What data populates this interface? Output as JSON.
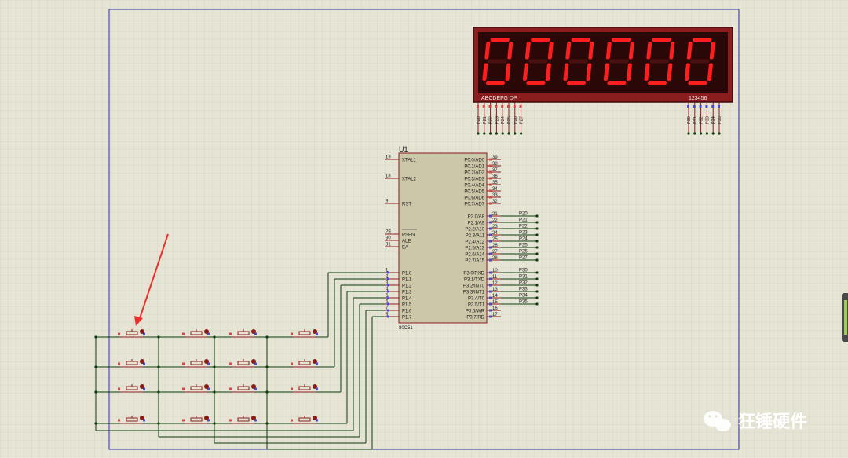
{
  "display": {
    "digits": [
      "0",
      "0",
      "0",
      "0",
      "0",
      "0"
    ],
    "seg_labels": "ABCDEFG  DP",
    "digit_labels": "123456",
    "seg_pins": [
      "P20",
      "P21",
      "P22",
      "P23",
      "P24",
      "P25",
      "P26",
      "P27"
    ],
    "dig_pins": [
      "P30",
      "P31",
      "P32",
      "P33",
      "P34",
      "P35"
    ]
  },
  "chip": {
    "ref": "U1",
    "part": "80C51",
    "left_pins": [
      {
        "num": "19",
        "name": "XTAL1"
      },
      {
        "num": "18",
        "name": "XTAL2"
      },
      {
        "num": "9",
        "name": "RST"
      },
      {
        "num": "29",
        "name": "PSEN"
      },
      {
        "num": "30",
        "name": "ALE"
      },
      {
        "num": "31",
        "name": "EA"
      },
      {
        "num": "1",
        "name": "P1.0"
      },
      {
        "num": "2",
        "name": "P1.1"
      },
      {
        "num": "3",
        "name": "P1.2"
      },
      {
        "num": "4",
        "name": "P1.3"
      },
      {
        "num": "5",
        "name": "P1.4"
      },
      {
        "num": "6",
        "name": "P1.5"
      },
      {
        "num": "7",
        "name": "P1.6"
      },
      {
        "num": "8",
        "name": "P1.7"
      }
    ],
    "p0_pins": [
      {
        "num": "39",
        "name": "P0.0/AD0"
      },
      {
        "num": "38",
        "name": "P0.1/AD1"
      },
      {
        "num": "37",
        "name": "P0.2/AD2"
      },
      {
        "num": "36",
        "name": "P0.3/AD3"
      },
      {
        "num": "35",
        "name": "P0.4/AD4"
      },
      {
        "num": "34",
        "name": "P0.5/AD5"
      },
      {
        "num": "33",
        "name": "P0.6/AD6"
      },
      {
        "num": "32",
        "name": "P0.7/AD7"
      }
    ],
    "p2_pins": [
      {
        "num": "21",
        "name": "P2.0/A8",
        "net": "P20"
      },
      {
        "num": "22",
        "name": "P2.1/A9",
        "net": "P21"
      },
      {
        "num": "23",
        "name": "P2.2/A10",
        "net": "P22"
      },
      {
        "num": "24",
        "name": "P2.3/A11",
        "net": "P23"
      },
      {
        "num": "25",
        "name": "P2.4/A12",
        "net": "P24"
      },
      {
        "num": "26",
        "name": "P2.5/A13",
        "net": "P25"
      },
      {
        "num": "27",
        "name": "P2.6/A14",
        "net": "P26"
      },
      {
        "num": "28",
        "name": "P2.7/A15",
        "net": "P27"
      }
    ],
    "p3_pins": [
      {
        "num": "10",
        "name": "P3.0/RXD",
        "net": "P30"
      },
      {
        "num": "11",
        "name": "P3.1/TXD",
        "net": "P31"
      },
      {
        "num": "12",
        "name": "P3.2/INT0",
        "net": "P32"
      },
      {
        "num": "13",
        "name": "P3.3/INT1",
        "net": "P33"
      },
      {
        "num": "14",
        "name": "P3.4/T0",
        "net": "P34"
      },
      {
        "num": "15",
        "name": "P3.5/T1",
        "net": "P35"
      },
      {
        "num": "16",
        "name": "P3.6/WR",
        "net": ""
      },
      {
        "num": "17",
        "name": "P3.7/RD",
        "net": ""
      }
    ]
  },
  "keypad": {
    "rows": 4,
    "cols": 4
  },
  "watermark": {
    "text": "狂锤硬件"
  },
  "colors": {
    "background": "#e6e4d4",
    "grid": "#cfcdbd",
    "border": "#2f2fa8",
    "wire": "#0b3d0b",
    "pin": "#8a1b1b",
    "chip_fill": "#cbc7a8",
    "display_bg": "#2a0808",
    "segment_on": "#ff1e1e",
    "arrow": "#e8312a"
  }
}
